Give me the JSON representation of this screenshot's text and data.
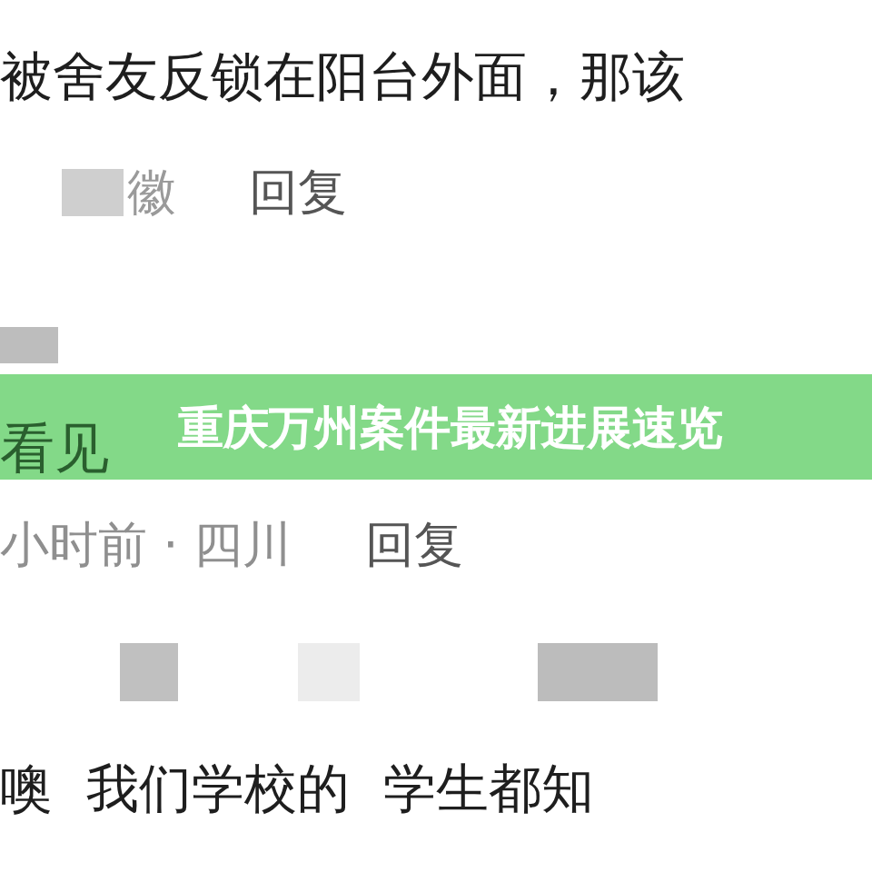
{
  "comments": [
    {
      "text": "被舍友反锁在阳台外面，那该",
      "meta": "徽",
      "reply": "回复"
    },
    {
      "text": "看见",
      "meta": "小时前 · 四川",
      "reply": "回复"
    },
    {
      "text": "噢  我们学校的  学生都知"
    }
  ],
  "banner": {
    "title": "重庆万州案件最新进展速览"
  }
}
